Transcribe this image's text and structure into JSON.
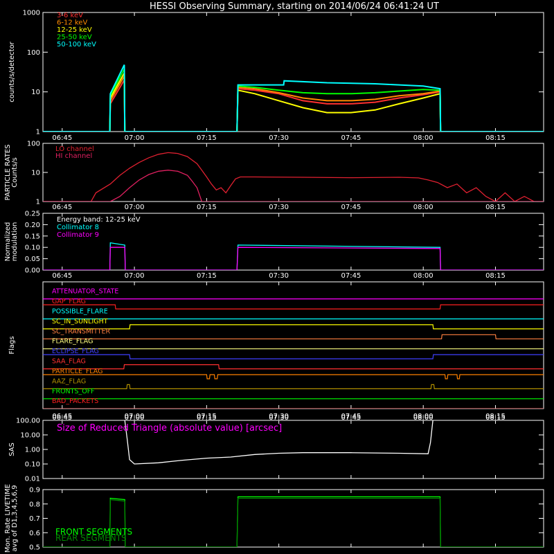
{
  "title": "HESSI Observing Summary, starting on 2014/06/24 06:41:24 UT",
  "colors": {
    "background": "#000000",
    "axes": "#ffffff",
    "band_3_6": "#ff3030",
    "band_6_12": "#ff8a00",
    "band_12_25": "#ffff00",
    "band_25_50": "#00ff00",
    "band_50_100": "#00ffff",
    "lo_channel": "#e02030",
    "hi_channel": "#e02060",
    "collimator_8": "#00ffff",
    "collimator_9": "#ff00ff",
    "sas": "#ffffff",
    "front": "#00ff00",
    "rear": "#008800"
  },
  "time_axis": {
    "start": "06:41:24",
    "range_min": [
      -4,
      100
    ],
    "tick_minutes": [
      0,
      15,
      30,
      45,
      60,
      75,
      90
    ],
    "tick_labels": [
      "06:45",
      "07:00",
      "07:15",
      "07:30",
      "07:45",
      "08:00",
      "08:15"
    ]
  },
  "chart_data": [
    {
      "type": "line",
      "name": "count-rates",
      "ylabel": "counts/s/detector",
      "yscale": "log",
      "ylim": [
        1,
        1000
      ],
      "ytick_labels": [
        "1",
        "10",
        "100",
        "1000"
      ],
      "x_unit": "minutes after 06:45",
      "series": [
        {
          "name": "3-6 keV",
          "color_key": "band_3_6",
          "x": [
            -4,
            9.9,
            10,
            12.9,
            13,
            36.3,
            36.5,
            40,
            45,
            50,
            55,
            60,
            65,
            70,
            75,
            78.5,
            78.6,
            100
          ],
          "y": [
            1,
            1,
            5,
            20,
            1,
            1,
            12,
            11,
            9,
            6,
            5,
            5,
            5.5,
            7,
            8.5,
            10,
            1,
            1
          ]
        },
        {
          "name": "6-12 keV",
          "color_key": "band_6_12",
          "x": [
            -4,
            9.9,
            10,
            12.9,
            13,
            36.3,
            36.5,
            40,
            45,
            50,
            55,
            60,
            65,
            70,
            75,
            78.5,
            78.6,
            100
          ],
          "y": [
            1,
            1,
            6,
            25,
            1,
            1,
            13,
            12,
            9.5,
            7,
            6,
            6,
            6.5,
            8,
            9,
            10.5,
            1,
            1
          ]
        },
        {
          "name": "12-25 keV",
          "color_key": "band_12_25",
          "x": [
            -4,
            9.9,
            10,
            12.9,
            13,
            36.3,
            36.5,
            40,
            45,
            50,
            55,
            60,
            65,
            70,
            75,
            78.5,
            78.6,
            100
          ],
          "y": [
            1,
            1,
            7,
            30,
            1,
            1,
            11,
            9,
            6,
            4,
            3,
            3,
            3.5,
            5,
            7,
            9,
            1,
            1
          ]
        },
        {
          "name": "25-50 keV",
          "color_key": "band_25_50",
          "x": [
            -4,
            9.9,
            10,
            12.9,
            13,
            36.3,
            36.5,
            40,
            45,
            50,
            55,
            60,
            65,
            70,
            75,
            78.5,
            78.6,
            100
          ],
          "y": [
            1,
            1,
            8,
            38,
            1,
            1,
            14,
            13,
            11,
            9.5,
            9,
            9,
            9.5,
            10.5,
            11.5,
            11,
            1,
            1
          ]
        },
        {
          "name": "50-100 keV",
          "color_key": "band_50_100",
          "x": [
            -4,
            9.9,
            10,
            12.9,
            13,
            36.3,
            36.5,
            46,
            46.1,
            55,
            65,
            75,
            78.5,
            78.6,
            100
          ],
          "y": [
            1,
            1,
            9,
            48,
            1,
            1,
            15,
            15,
            19,
            17,
            16,
            14,
            12,
            1,
            1
          ]
        }
      ]
    },
    {
      "type": "line",
      "name": "particle-rates",
      "ylabel": "PARTICLE RATES Counts/s",
      "yscale": "log",
      "ylim": [
        1,
        100
      ],
      "ytick_labels": [
        "1",
        "10",
        "100"
      ],
      "series": [
        {
          "name": "LO channel",
          "color_key": "lo_channel",
          "x": [
            -4,
            6,
            7,
            10,
            12,
            14,
            16,
            18,
            20,
            22,
            24,
            26,
            28,
            29,
            30,
            31,
            32,
            33,
            34,
            35,
            36,
            37,
            40,
            50,
            60,
            70,
            74,
            76,
            78,
            80,
            82,
            84,
            86,
            88,
            90,
            92,
            94,
            96,
            98,
            100
          ],
          "y": [
            1,
            1,
            2,
            4,
            8,
            14,
            22,
            32,
            42,
            48,
            45,
            35,
            20,
            12,
            7,
            4,
            2.5,
            3,
            2,
            3.5,
            6,
            7,
            7,
            6.8,
            6.6,
            6.8,
            6.5,
            5.5,
            4.5,
            3,
            4,
            2,
            3,
            1.5,
            1,
            2,
            1,
            1.5,
            1,
            1
          ]
        },
        {
          "name": "HI channel",
          "color_key": "hi_channel",
          "x": [
            -4,
            10,
            12,
            14,
            16,
            18,
            20,
            22,
            24,
            26,
            27,
            28,
            29,
            100
          ],
          "y": [
            1,
            1,
            1.5,
            3,
            5.5,
            8.5,
            11,
            12,
            11,
            8,
            5,
            3,
            1,
            1
          ]
        }
      ]
    },
    {
      "type": "line",
      "name": "modulation",
      "ylabel": "Normalized modulation",
      "annotation": "Energy band: 12-25 keV",
      "ylim": [
        0,
        0.25
      ],
      "ytick_labels": [
        "0.00",
        "0.05",
        "0.10",
        "0.15",
        "0.20",
        "0.25"
      ],
      "series": [
        {
          "name": "Collimator 8",
          "color_key": "collimator_8",
          "x": [
            -4,
            9.9,
            10,
            13,
            13.1,
            36.3,
            36.5,
            78.5,
            78.6,
            100
          ],
          "y": [
            0,
            0,
            0.12,
            0.11,
            0,
            0,
            0.11,
            0.1,
            0,
            0
          ]
        },
        {
          "name": "Collimator 9",
          "color_key": "collimator_9",
          "x": [
            -4,
            9.9,
            10,
            13,
            13.1,
            36.3,
            36.5,
            78.5,
            78.6,
            100
          ],
          "y": [
            0,
            0,
            0.1,
            0.1,
            0,
            0,
            0.1,
            0.095,
            0,
            0
          ]
        }
      ]
    },
    {
      "type": "line",
      "name": "flags",
      "ylabel": "Flags",
      "flags": [
        {
          "name": "ATTENUATOR_STATE",
          "color": "#ff00ff",
          "x": [
            -4,
            100
          ],
          "on": [
            0,
            0
          ]
        },
        {
          "name": "GAP_FLAG",
          "color": "#ff2020",
          "x": [
            -4,
            11,
            11.1,
            78.5,
            78.6,
            100
          ],
          "on": [
            1,
            1,
            0,
            0,
            1,
            1
          ]
        },
        {
          "name": "POSSIBLE_FLARE",
          "color": "#00ffff",
          "x": [
            -4,
            100
          ],
          "on": [
            0,
            0
          ]
        },
        {
          "name": "SC_IN_SUNLIGHT",
          "color": "#ffff00",
          "x": [
            -4,
            14,
            14.1,
            77,
            77.1,
            100
          ],
          "on": [
            0,
            0,
            1,
            1,
            0,
            0
          ]
        },
        {
          "name": "SC_TRANSMITTER",
          "color": "#ff8040",
          "x": [
            -4,
            78.8,
            78.9,
            90,
            90.1,
            100
          ],
          "on": [
            0,
            0,
            1,
            1,
            0,
            0
          ]
        },
        {
          "name": "FLARE_FLAG",
          "color": "#ffff80",
          "x": [
            -4,
            100
          ],
          "on": [
            0,
            0
          ]
        },
        {
          "name": "ECLIPSE_FLAG",
          "color": "#4040ff",
          "x": [
            -4,
            14,
            14.1,
            77,
            77.1,
            100
          ],
          "on": [
            1,
            1,
            0,
            0,
            1,
            1
          ]
        },
        {
          "name": "SAA_FLAG",
          "color": "#ff3030",
          "x": [
            -4,
            12.8,
            12.9,
            32.5,
            32.6,
            100
          ],
          "on": [
            0,
            0,
            1,
            1,
            0,
            0
          ]
        },
        {
          "name": "PARTICLE_FLAG",
          "color": "#ff8000",
          "x": [
            -4,
            30,
            30.1,
            30.6,
            30.7,
            31.6,
            31.7,
            32.2,
            32.3,
            79.5,
            79.6,
            80,
            80.1,
            82,
            82.1,
            82.5,
            82.6,
            100
          ],
          "on": [
            1,
            1,
            0,
            0,
            1,
            1,
            0,
            0,
            1,
            1,
            0,
            0,
            1,
            1,
            0,
            0,
            1,
            1
          ]
        },
        {
          "name": "AAZ_FLAG",
          "color": "#b09000",
          "x": [
            -4,
            13.4,
            13.5,
            14,
            14.1,
            76.6,
            76.7,
            77.2,
            77.3,
            100
          ],
          "on": [
            0,
            0,
            1,
            1,
            0,
            0,
            1,
            1,
            0,
            0
          ]
        },
        {
          "name": "FRONTS_OFF",
          "color": "#00ff00",
          "x": [
            -4,
            100
          ],
          "on": [
            0,
            0
          ]
        },
        {
          "name": "BAD_PACKETS",
          "color": "#ff2020",
          "x": [
            -4,
            100
          ],
          "on": [
            0,
            0
          ]
        }
      ]
    },
    {
      "type": "line",
      "name": "sas",
      "ylabel": "SAS",
      "yscale": "log",
      "ylim": [
        0.01,
        100
      ],
      "ytick_labels": [
        "0.01",
        "0.10",
        "1.00",
        "10.00",
        "100.00"
      ],
      "annotation": "Size of Reduced Triangle (absolute value) [arcsec]",
      "series": [
        {
          "name": "",
          "color_key": "sas",
          "x": [
            13,
            13.5,
            14,
            15,
            20,
            25,
            30,
            35,
            40,
            45,
            50,
            60,
            70,
            76,
            76.5,
            77
          ],
          "y": [
            100,
            5,
            0.2,
            0.1,
            0.12,
            0.18,
            0.25,
            0.3,
            0.45,
            0.55,
            0.6,
            0.6,
            0.55,
            0.5,
            3,
            100
          ]
        }
      ]
    },
    {
      "type": "line",
      "name": "livetime",
      "ylabel": "Mon. Rate LIVETIME avg of D1,3,4,5,6,9",
      "ylim": [
        0.5,
        0.9
      ],
      "ytick_labels": [
        "0.5",
        "0.6",
        "0.7",
        "0.8",
        "0.9"
      ],
      "series": [
        {
          "name": "FRONT SEGMENTS",
          "color_key": "front",
          "x": [
            -4,
            9.9,
            10,
            13,
            13.1,
            36.3,
            36.5,
            78.5,
            78.6,
            100
          ],
          "y": [
            0.5,
            0.5,
            0.84,
            0.83,
            0.5,
            0.5,
            0.85,
            0.85,
            0.5,
            0.5
          ]
        },
        {
          "name": "REAR SEGMENTS",
          "color_key": "rear",
          "x": [
            -4,
            9.9,
            10,
            13,
            13.1,
            36.3,
            36.5,
            78.5,
            78.6,
            100
          ],
          "y": [
            0.5,
            0.5,
            0.83,
            0.82,
            0.5,
            0.5,
            0.84,
            0.84,
            0.5,
            0.5
          ]
        }
      ]
    }
  ]
}
